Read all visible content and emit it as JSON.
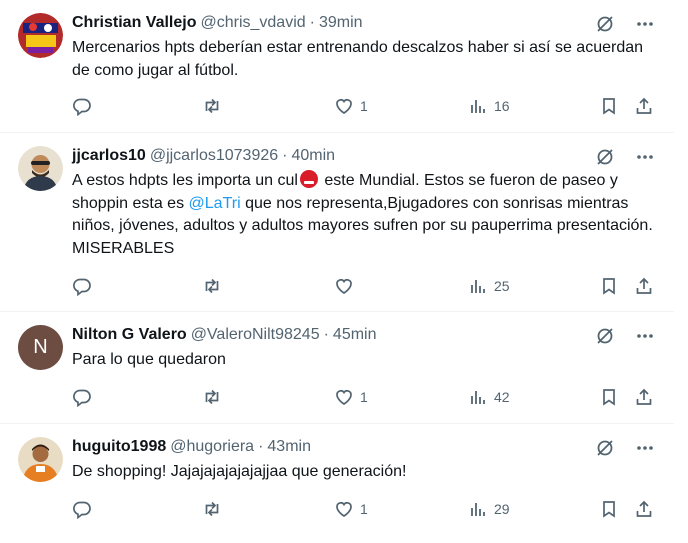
{
  "tweets": [
    {
      "name": "Christian Vallejo",
      "handle": "@chris_vdavid",
      "time": "39min",
      "text": "Mercenarios hpts deberían estar entrenando descalzos haber si así se acuerdan de como jugar al fútbol.",
      "replies": "",
      "retweets": "",
      "likes": "1",
      "views": "16",
      "avatar_color": "#b22a2a"
    },
    {
      "name": "jjcarlos10",
      "handle": "@jjcarlos1073926",
      "time": "40min",
      "text_before_emoji": "A estos hdpts les importa un cul",
      "text_after_emoji": " este Mundial.  Estos se fueron de paseo y shoppin esta es ",
      "mention": "@LaTri",
      "text_after_mention": " que nos representa,Bjugadores con sonrisas mientras niños, jóvenes, adultos y adultos mayores sufren por su pauperrima presentación. MISERABLES",
      "replies": "",
      "retweets": "",
      "likes": "",
      "views": "25",
      "avatar_color": "#c9a47a"
    },
    {
      "name": "Nilton G Valero",
      "handle": "@ValeroNilt98245",
      "time": "45min",
      "text": "Para lo que quedaron",
      "replies": "",
      "retweets": "",
      "likes": "1",
      "views": "42",
      "avatar_letter": "N",
      "avatar_color": "#6d4c41"
    },
    {
      "name": "huguito1998",
      "handle": "@hugoriera",
      "time": "43min",
      "text": "De shopping! Jajajajajajajajjaa que generación!",
      "replies": "",
      "retweets": "",
      "likes": "1",
      "views": "29",
      "avatar_color": "#d98c3a"
    }
  ],
  "separator": "·",
  "colors": {
    "text": "#0f1419",
    "secondary": "#536471",
    "link": "#1d9bf0",
    "border": "#eff3f4"
  }
}
